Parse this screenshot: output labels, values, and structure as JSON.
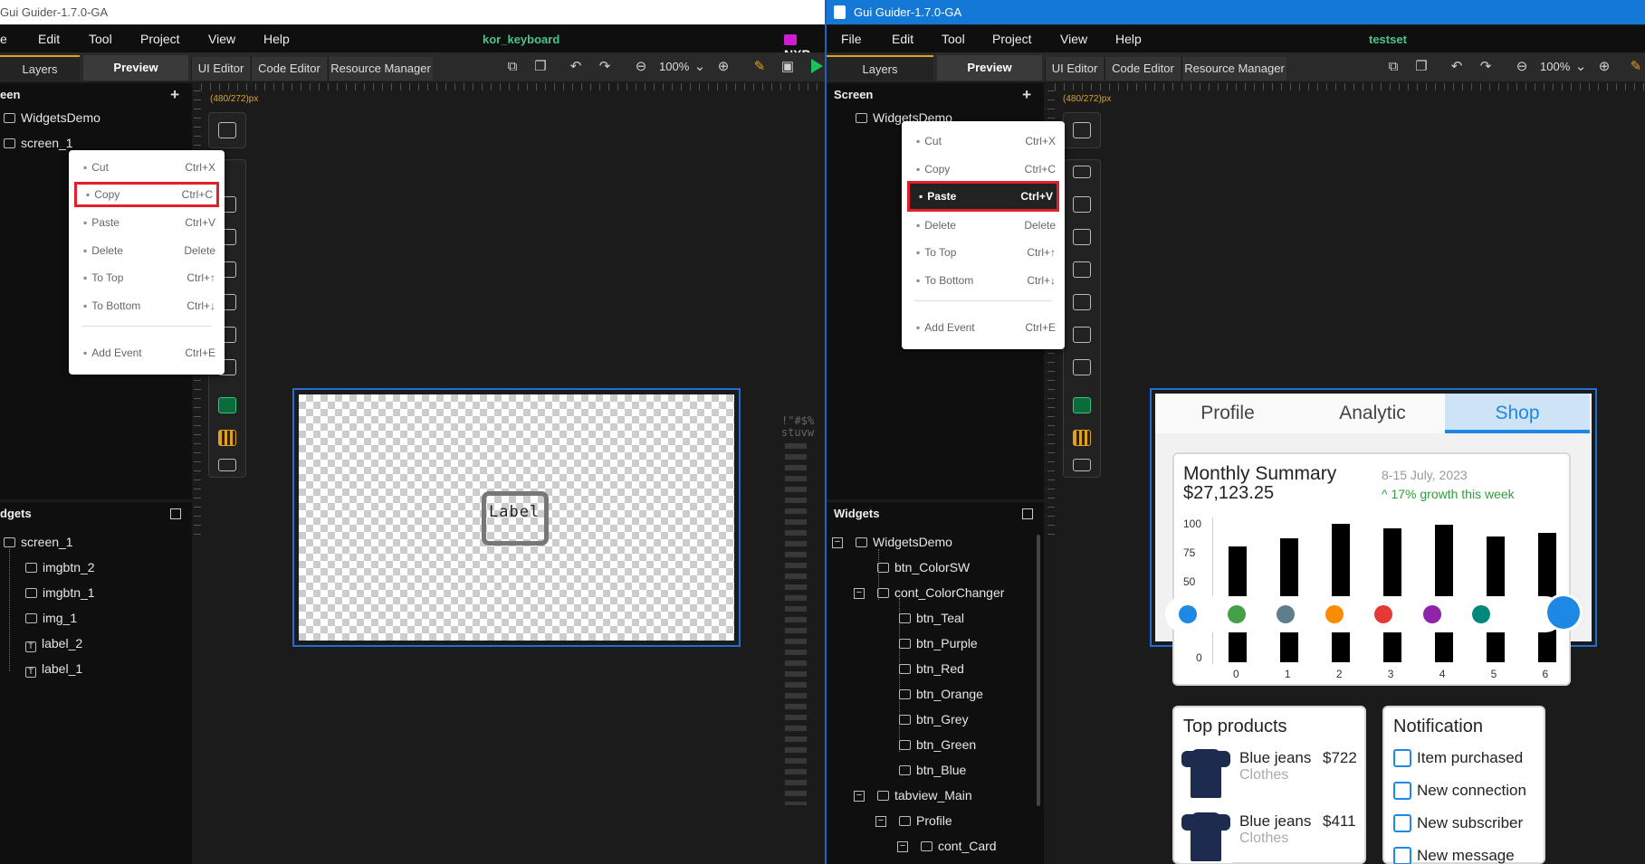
{
  "left": {
    "title": "Gui Guider-1.7.0-GA",
    "menu": [
      "e",
      "Edit",
      "Tool",
      "Project",
      "View",
      "Help"
    ],
    "project_name": "kor_keyboard",
    "brand": "NXP",
    "tabs": {
      "layers": "Layers",
      "preview": "Preview",
      "ui_editor": "UI Editor",
      "code_editor": "Code Editor",
      "resource_manager": "Resource Manager"
    },
    "zoom": "100%",
    "screen_panel_title": "een",
    "screens": [
      "WidgetsDemo",
      "screen_1"
    ],
    "widgets_panel_title": "dgets",
    "widget_tree": [
      {
        "label": "screen_1",
        "icon": "screen-icon"
      },
      {
        "label": "imgbtn_2",
        "icon": "imgbtn-icon"
      },
      {
        "label": "imgbtn_1",
        "icon": "imgbtn-icon"
      },
      {
        "label": "img_1",
        "icon": "image-icon"
      },
      {
        "label": "label_2",
        "icon": "text-icon"
      },
      {
        "label": "label_1",
        "icon": "text-icon"
      }
    ],
    "context_menu": [
      {
        "label": "Cut",
        "shortcut": "Ctrl+X"
      },
      {
        "label": "Copy",
        "shortcut": "Ctrl+C",
        "highlighted": true
      },
      {
        "label": "Paste",
        "shortcut": "Ctrl+V"
      },
      {
        "label": "Delete",
        "shortcut": "Delete"
      },
      {
        "label": "To Top",
        "shortcut": "Ctrl+↑"
      },
      {
        "label": "To Bottom",
        "shortcut": "Ctrl+↓"
      },
      {
        "label": "Add Event",
        "shortcut": "Ctrl+E"
      }
    ],
    "resolution": "(480/272)px",
    "canvas_label": "Label",
    "stray_text": "!\"#$% stuvw"
  },
  "right": {
    "title": "Gui Guider-1.7.0-GA",
    "menu": [
      "File",
      "Edit",
      "Tool",
      "Project",
      "View",
      "Help"
    ],
    "project_name": "testset",
    "tabs": {
      "layers": "Layers",
      "preview": "Preview",
      "ui_editor": "UI Editor",
      "code_editor": "Code Editor",
      "resource_manager": "Resource Manager"
    },
    "zoom": "100%",
    "screen_panel_title": "Screen",
    "screens": [
      "WidgetsDemo"
    ],
    "widgets_panel_title": "Widgets",
    "widget_tree": [
      {
        "label": "WidgetsDemo",
        "expander": "−",
        "icon": "screen-icon"
      },
      {
        "label": "btn_ColorSW",
        "icon": "button-icon"
      },
      {
        "label": "cont_ColorChanger",
        "expander": "−",
        "icon": "container-icon"
      },
      {
        "label": "btn_Teal",
        "icon": "button-icon"
      },
      {
        "label": "btn_Purple",
        "icon": "button-icon"
      },
      {
        "label": "btn_Red",
        "icon": "button-icon"
      },
      {
        "label": "btn_Orange",
        "icon": "button-icon"
      },
      {
        "label": "btn_Grey",
        "icon": "button-icon"
      },
      {
        "label": "btn_Green",
        "icon": "button-icon"
      },
      {
        "label": "btn_Blue",
        "icon": "button-icon"
      },
      {
        "label": "tabview_Main",
        "expander": "−",
        "icon": "container-icon"
      },
      {
        "label": "Profile",
        "expander": "−",
        "icon": "page-icon"
      },
      {
        "label": "cont_Card",
        "expander": "−",
        "icon": "container-icon"
      }
    ],
    "context_menu": [
      {
        "label": "Cut",
        "shortcut": "Ctrl+X"
      },
      {
        "label": "Copy",
        "shortcut": "Ctrl+C"
      },
      {
        "label": "Paste",
        "shortcut": "Ctrl+V",
        "highlighted": true
      },
      {
        "label": "Delete",
        "shortcut": "Delete"
      },
      {
        "label": "To Top",
        "shortcut": "Ctrl+↑"
      },
      {
        "label": "To Bottom",
        "shortcut": "Ctrl+↓"
      },
      {
        "label": "Add Event",
        "shortcut": "Ctrl+E"
      }
    ],
    "resolution": "(480/272)px",
    "device": {
      "tabs": [
        "Profile",
        "Analytic",
        "Shop"
      ],
      "active_tab": "Shop",
      "summary_title": "Monthly Summary",
      "summary_amount": "$27,123.25",
      "summary_date": "8-15 July, 2023",
      "summary_growth": "^ 17% growth this week",
      "y_ticks": [
        "100",
        "75",
        "50",
        "0"
      ],
      "x_ticks": [
        "0",
        "1",
        "2",
        "3",
        "4",
        "5",
        "6"
      ],
      "bars_top": [
        70,
        80,
        98,
        92,
        97,
        82,
        87
      ],
      "color_dots": [
        "#1e88e5",
        "#43a047",
        "#607d8b",
        "#fb8c00",
        "#e53935",
        "#8e24aa",
        "#00897b"
      ],
      "products_title": "Top products",
      "products": [
        {
          "name": "Blue jeans",
          "price": "$722",
          "category": "Clothes"
        },
        {
          "name": "Blue jeans",
          "price": "$411",
          "category": "Clothes"
        }
      ],
      "notification_title": "Notification",
      "notifications": [
        "Item purchased",
        "New connection",
        "New subscriber",
        "New message"
      ]
    }
  }
}
